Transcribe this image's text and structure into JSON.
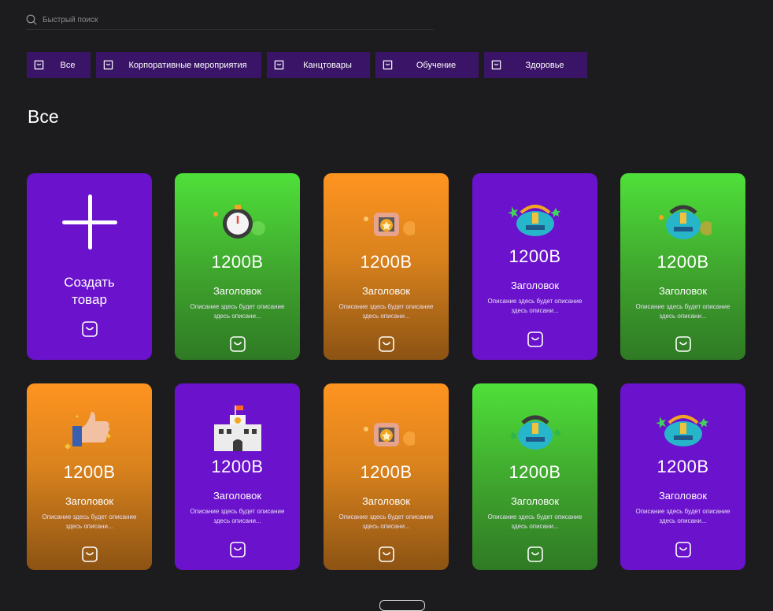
{
  "search": {
    "placeholder": "Быстрый поиск"
  },
  "categories": [
    {
      "label": "Все",
      "icon": "bag-icon"
    },
    {
      "label": "Корпоративные мероприятия",
      "icon": "bag-icon"
    },
    {
      "label": "Канцтовары",
      "icon": "bag-icon"
    },
    {
      "label": "Обучение",
      "icon": "bag-icon"
    },
    {
      "label": "Здоровье",
      "icon": "bag-icon"
    }
  ],
  "section_title": "Все",
  "create_card": {
    "label": "Создать товар",
    "icon": "plus-icon"
  },
  "colors": {
    "purple": "#6a12cc",
    "green": "#4fe03a",
    "orange": "#ff9420",
    "chip": "#3a1467",
    "background": "#1c1c1e"
  },
  "products": [
    {
      "price": "1200B",
      "title": "Заголовок",
      "description": "Описание здесь будет описание здесь описани...",
      "color": "green",
      "icon": "stopwatch-icon"
    },
    {
      "price": "1200B",
      "title": "Заголовок",
      "description": "Описание здесь будет описание здесь описани...",
      "color": "orange",
      "icon": "medal-gift-icon"
    },
    {
      "price": "1200B",
      "title": "Заголовок",
      "description": "Описание здесь будет описание здесь описани...",
      "color": "purple",
      "icon": "trophy-island-icon"
    },
    {
      "price": "1200B",
      "title": "Заголовок",
      "description": "Описание здесь будет описание здесь описани...",
      "color": "green",
      "icon": "trophy-island-icon"
    },
    {
      "price": "1200B",
      "title": "Заголовок",
      "description": "Описание здесь будет описание здесь описани...",
      "color": "orange",
      "icon": "thumbs-up-icon"
    },
    {
      "price": "1200B",
      "title": "Заголовок",
      "description": "Описание здесь будет описание здесь описани...",
      "color": "purple",
      "icon": "school-building-icon"
    },
    {
      "price": "1200B",
      "title": "Заголовок",
      "description": "Описание здесь будет описание здесь описани...",
      "color": "orange",
      "icon": "medal-gift-icon"
    },
    {
      "price": "1200B",
      "title": "Заголовок",
      "description": "Описание здесь будет описание здесь описани...",
      "color": "green",
      "icon": "trophy-island-icon"
    },
    {
      "price": "1200B",
      "title": "Заголовок",
      "description": "Описание здесь будет описание здесь описани...",
      "color": "purple",
      "icon": "trophy-island-icon"
    }
  ]
}
